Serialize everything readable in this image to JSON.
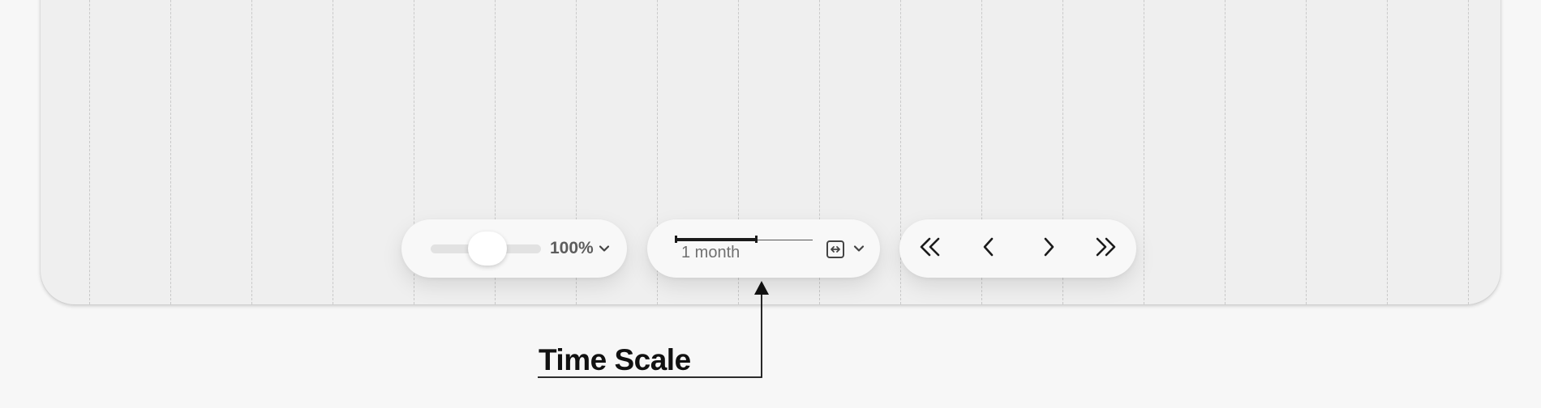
{
  "zoom": {
    "level_label": "100%",
    "slider_fraction": 0.5
  },
  "time_scale": {
    "label": "1 month"
  },
  "navigation": {
    "buttons": [
      "first-page",
      "previous",
      "next",
      "last-page"
    ]
  },
  "callout": {
    "label": "Time Scale"
  },
  "icons": {
    "zoom_dropdown": "chevron-down-icon",
    "fit": "fit-width-icon",
    "scale_dropdown": "chevron-down-icon",
    "first": "double-chevron-left-icon",
    "prev": "chevron-left-icon",
    "next": "chevron-right-icon",
    "last": "double-chevron-right-icon"
  },
  "colors": {
    "background": "#f7f7f7",
    "canvas": "#efefef",
    "pill": "#f8f8f8",
    "text_muted": "#5d5d5d",
    "ink": "#111111"
  }
}
